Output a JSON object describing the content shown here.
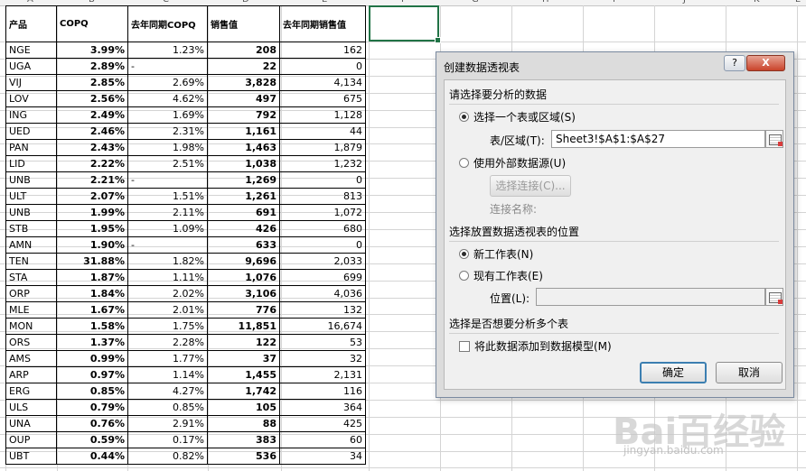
{
  "sheet": {
    "col_letters": [
      "A",
      "B",
      "C",
      "D",
      "E",
      "F",
      "G",
      "H",
      "I",
      "J",
      "K",
      "L"
    ],
    "headers": [
      "产品",
      "COPQ",
      "去年同期COPQ",
      "销售值",
      "去年同期销售值"
    ],
    "rows": [
      [
        "NGE",
        "3.99%",
        "1.23%",
        "208",
        "162"
      ],
      [
        "UGA",
        "2.89%",
        "-",
        "22",
        "0"
      ],
      [
        "VIJ",
        "2.85%",
        "2.69%",
        "3,828",
        "4,134"
      ],
      [
        "LOV",
        "2.56%",
        "4.62%",
        "497",
        "675"
      ],
      [
        "ING",
        "2.49%",
        "1.69%",
        "792",
        "1,128"
      ],
      [
        "UED",
        "2.46%",
        "2.31%",
        "1,161",
        "44"
      ],
      [
        "PAN",
        "2.43%",
        "1.98%",
        "1,463",
        "1,879"
      ],
      [
        "LID",
        "2.22%",
        "2.51%",
        "1,038",
        "1,232"
      ],
      [
        "UNB",
        "2.21%",
        "-",
        "1,269",
        "0"
      ],
      [
        "ULT",
        "2.07%",
        "1.51%",
        "1,261",
        "813"
      ],
      [
        "UNB",
        "1.99%",
        "2.11%",
        "691",
        "1,072"
      ],
      [
        "STB",
        "1.95%",
        "1.09%",
        "426",
        "680"
      ],
      [
        "AMN",
        "1.90%",
        "-",
        "633",
        "0"
      ],
      [
        "TEN",
        "31.88%",
        "1.82%",
        "9,696",
        "2,033"
      ],
      [
        "STA",
        "1.87%",
        "1.11%",
        "1,076",
        "699"
      ],
      [
        "ORP",
        "1.84%",
        "2.02%",
        "3,106",
        "4,036"
      ],
      [
        "MLE",
        "1.67%",
        "2.01%",
        "776",
        "132"
      ],
      [
        "MON",
        "1.58%",
        "1.75%",
        "11,851",
        "16,674"
      ],
      [
        "ORS",
        "1.37%",
        "2.28%",
        "122",
        "53"
      ],
      [
        "AMS",
        "0.99%",
        "1.77%",
        "37",
        "32"
      ],
      [
        "ARP",
        "0.97%",
        "1.14%",
        "1,455",
        "2,131"
      ],
      [
        "ERG",
        "0.85%",
        "4.27%",
        "1,742",
        "116"
      ],
      [
        "ULS",
        "0.79%",
        "0.85%",
        "105",
        "364"
      ],
      [
        "UNA",
        "0.76%",
        "2.91%",
        "88",
        "425"
      ],
      [
        "OUP",
        "0.59%",
        "0.17%",
        "383",
        "60"
      ],
      [
        "UBT",
        "0.44%",
        "0.82%",
        "536",
        "34"
      ]
    ]
  },
  "dialog": {
    "title": "创建数据透视表",
    "help_label": "?",
    "close_label": "X",
    "section1": "请选择要分析的数据",
    "opt_table_range": "选择一个表或区域(S)",
    "table_range_label": "表/区域(T):",
    "table_range_value": "Sheet3!$A$1:$A$27",
    "opt_external": "使用外部数据源(U)",
    "choose_conn_button": "选择连接(C)...",
    "conn_name_label": "连接名称:",
    "section2": "选择放置数据透视表的位置",
    "opt_new_sheet": "新工作表(N)",
    "opt_existing_sheet": "现有工作表(E)",
    "location_label": "位置(L):",
    "location_value": "",
    "section3": "选择是否想要分析多个表",
    "add_to_model": "将此数据添加到数据模型(M)",
    "ok": "确定",
    "cancel": "取消"
  },
  "watermark": {
    "logo_text": "Bai百经验",
    "url": "jingyan.baidu.com"
  }
}
